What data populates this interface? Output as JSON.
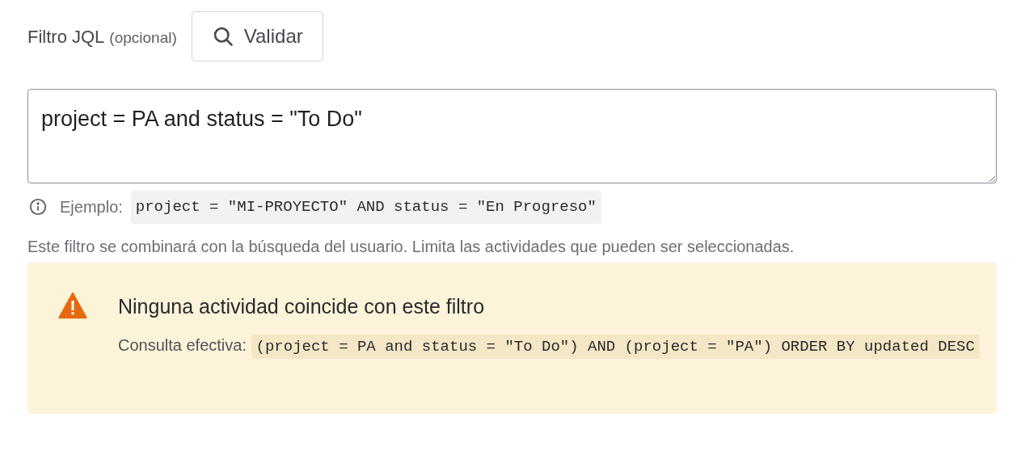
{
  "field": {
    "label": "Filtro JQL",
    "optional_note": "(opcional)",
    "validate_button": "Validar",
    "value": "project = PA and status = \"To Do\""
  },
  "example": {
    "label": "Ejemplo:",
    "code": "project = \"MI-PROYECTO\" AND status = \"En Progreso\""
  },
  "help_text": "Este filtro se combinará con la búsqueda del usuario. Limita las actividades que pueden ser seleccionadas.",
  "warning": {
    "title": "Ninguna actividad coincide con este filtro",
    "query_label": "Consulta efectiva:",
    "query": "(project = PA and status = \"To Do\") AND (project = \"PA\") ORDER BY updated DESC"
  }
}
